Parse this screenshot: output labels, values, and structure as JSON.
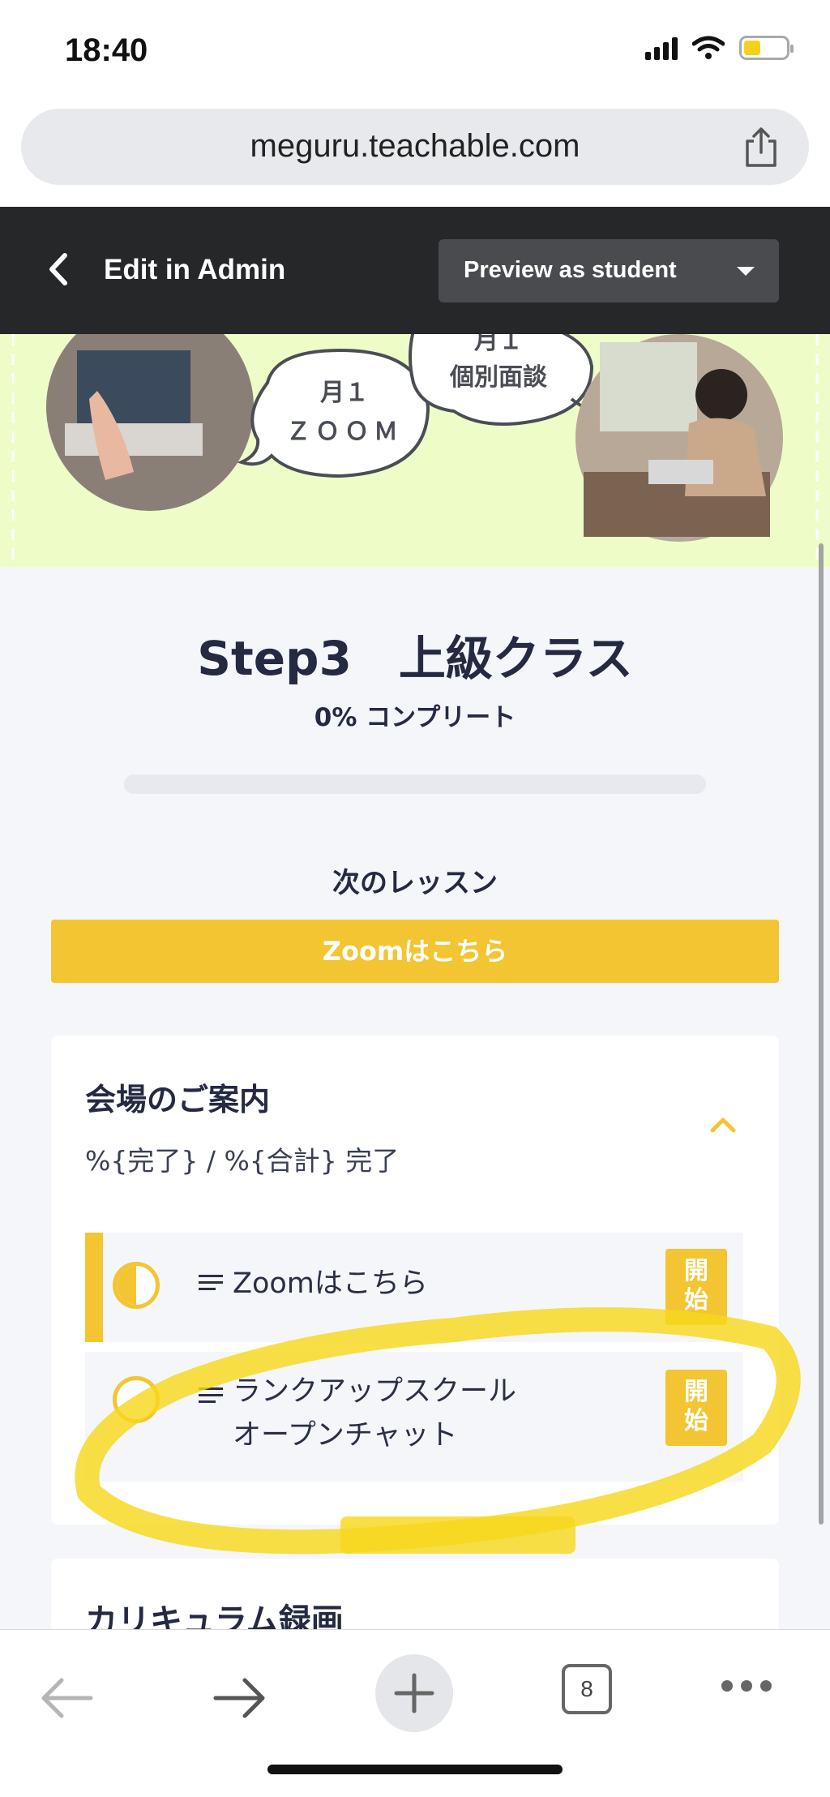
{
  "status_bar": {
    "time": "18:40",
    "icons": [
      "signal-icon",
      "wifi-icon",
      "battery-icon"
    ],
    "battery_fill": 0.4
  },
  "browser": {
    "url": "meguru.teachable.com",
    "tab_count": "8"
  },
  "admin_bar": {
    "edit_label": "Edit in Admin",
    "preview_label": "Preview as student"
  },
  "banner": {
    "bubble_left": [
      "月１",
      "ＺＯＯＭ"
    ],
    "bubble_right": [
      "月１",
      "個別面談"
    ]
  },
  "course": {
    "title": "Step3　上級クラス",
    "complete_text": "0% コンプリート",
    "progress": 0,
    "next_lesson_heading": "次のレッスン",
    "next_lesson_button": "Zoomはこちら"
  },
  "section": {
    "title": "会場のご案内",
    "progress_text": "%{完了} / %{合計} 完了",
    "lessons": [
      {
        "title": "Zoomはこちら",
        "start_label": [
          "開",
          "始"
        ],
        "status": "in-progress"
      },
      {
        "title": [
          "ランクアップスクール",
          "オープンチャット"
        ],
        "start_label": [
          "開",
          "始"
        ],
        "status": "not-started"
      }
    ]
  },
  "section2": {
    "title": "カリキュラム録画"
  },
  "colors": {
    "accent": "#f3c532",
    "admin_bar": "#262729",
    "banner_bg": "#eefcc8",
    "highlight": "#f7d81c"
  }
}
